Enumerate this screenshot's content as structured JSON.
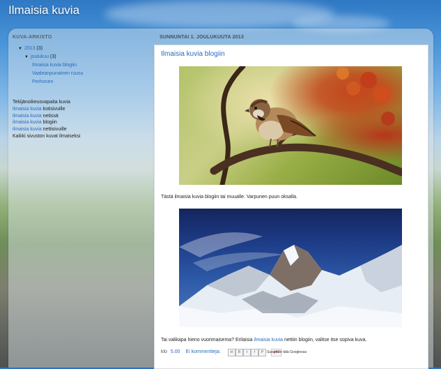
{
  "blog": {
    "title": "Ilmaisia kuvia"
  },
  "sidebar": {
    "archive_heading": "KUVA-ARKISTO",
    "year": {
      "label": "2013",
      "count": "(3)"
    },
    "month": {
      "label": "joulukuu",
      "count": "(3)"
    },
    "posts": [
      "Ilmaisia kuvia blogiin",
      "Vaaleanpunainen ruusu",
      "Perhonen"
    ],
    "promo": [
      {
        "link": "",
        "text": "Tekijänoikeusvapaita kuvia"
      },
      {
        "link": "ilmaisia kuvia",
        "text": " kotisivuille"
      },
      {
        "link": "ilmaisia kuvia",
        "text": " netissä"
      },
      {
        "link": "ilmaisia kuvia",
        "text": " blogiin"
      },
      {
        "link": "ilmaisia kuvia",
        "text": " nettisivuille"
      },
      {
        "link": "",
        "text": "Kaikki sivuston kuvat ilmaiseksi"
      }
    ]
  },
  "post": {
    "date_header": "SUNNUNTAI 1. JOULUKUUTA 2013",
    "title": "Ilmaisia kuvia blogiin",
    "caption1": "Tästä ilmaisia kuvia blogiin tai muualle. Varpunen puun oksalla.",
    "caption2_pre": "Tai valikapa hieno vuorimaisema? Erilaisia ",
    "caption2_link": "ilmaisia kuvia",
    "caption2_post": " nettiin blogiin, valitse itse sopiva kuva.",
    "footer_prefix": "klo",
    "time": "5.00",
    "comments": "Ei kommentteja:",
    "share": {
      "icons": [
        "email-icon",
        "blog-this-icon",
        "twitter-icon",
        "facebook-icon",
        "pinterest-icon"
      ],
      "gplus_label": "g+1",
      "recommend": "Suosittele tätä Googlessa"
    }
  }
}
